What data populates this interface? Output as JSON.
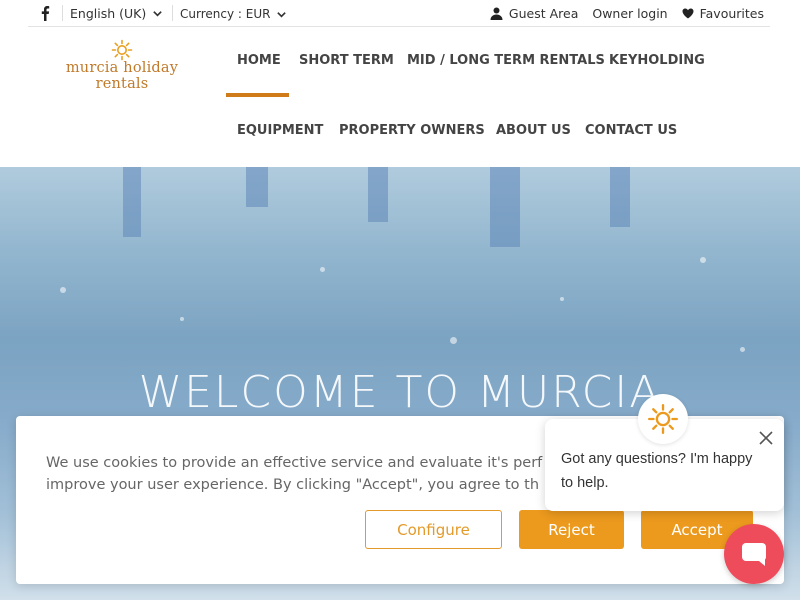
{
  "topbar": {
    "language": "English (UK)",
    "currency": "Currency : EUR",
    "guest_area": "Guest Area",
    "owner_login": "Owner login",
    "favourites": "Favourites"
  },
  "logo": {
    "text": "murcia holiday rentals"
  },
  "nav": {
    "items": [
      {
        "label": "HOME",
        "active": true
      },
      {
        "label": "SHORT TERM"
      },
      {
        "label": "MID / LONG TERM RENTALS"
      },
      {
        "label": "KEYHOLDING"
      },
      {
        "label": "EQUIPMENT"
      },
      {
        "label": "PROPERTY OWNERS"
      },
      {
        "label": "ABOUT US"
      },
      {
        "label": "CONTACT US"
      }
    ]
  },
  "hero": {
    "title": "WELCOME TO MURCIA"
  },
  "cookie": {
    "message": "We use cookies to provide an effective service and evaluate it's perf… improve your user experience. By clicking \"Accept\", you agree to th…",
    "line1": "We use cookies to provide an effective service and evaluate it's perf",
    "line2": "improve your user experience. By clicking \"Accept\", you agree to th",
    "configure": "Configure",
    "reject": "Reject",
    "accept": "Accept"
  },
  "chat": {
    "message": "Got any questions? I'm happy to help."
  },
  "colors": {
    "accent": "#ec9a1e",
    "nav_active": "#d07b1a",
    "chat_launcher": "#ee4b5b",
    "logo": "#c07a2a"
  }
}
